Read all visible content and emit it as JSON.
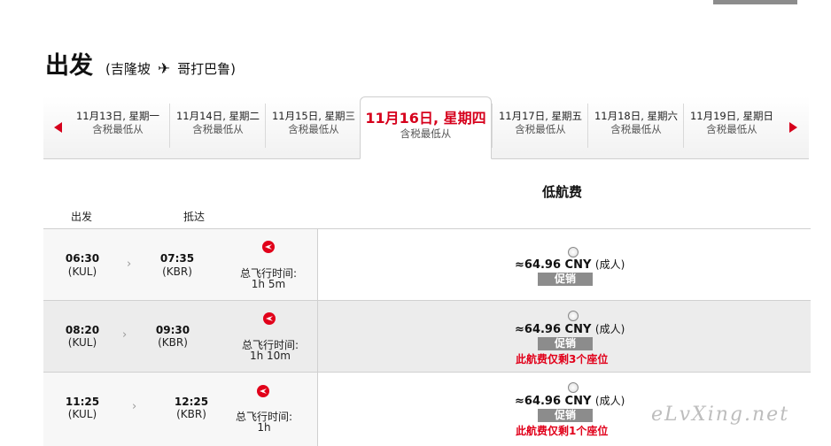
{
  "header": {
    "title": "出发",
    "origin": "(吉隆坡",
    "destination": "哥打巴鲁)"
  },
  "date_tabs": [
    {
      "date": "11月13日, 星期一",
      "sub": "含税最低从"
    },
    {
      "date": "11月14日, 星期二",
      "sub": "含税最低从"
    },
    {
      "date": "11月15日, 星期三",
      "sub": "含税最低从"
    },
    {
      "date": "11月16日, 星期四",
      "sub": "含税最低从",
      "selected": true
    },
    {
      "date": "11月17日, 星期五",
      "sub": "含税最低从"
    },
    {
      "date": "11月18日, 星期六",
      "sub": "含税最低从"
    },
    {
      "date": "11月19日, 星期日",
      "sub": "含税最低从"
    }
  ],
  "columns": {
    "departure": "出发",
    "arrival": "抵达",
    "fare": "低航费"
  },
  "flights": [
    {
      "dep_time": "06:30",
      "dep_code": "(KUL)",
      "arr_time": "07:35",
      "arr_code": "(KBR)",
      "duration_label": "总飞行时间:",
      "duration": "1h 5m",
      "price": "≈64.96 CNY",
      "pax": "(成人)",
      "promo": "促销",
      "seats": ""
    },
    {
      "dep_time": "08:20",
      "dep_code": "(KUL)",
      "arr_time": "09:30",
      "arr_code": "(KBR)",
      "duration_label": "总飞行时间:",
      "duration": "1h 10m",
      "price": "≈64.96 CNY",
      "pax": "(成人)",
      "promo": "促销",
      "seats": "此航费仅剩3个座位"
    },
    {
      "dep_time": "11:25",
      "dep_code": "(KUL)",
      "arr_time": "12:25",
      "arr_code": "(KBR)",
      "duration_label": "总飞行时间:",
      "duration": "1h",
      "price": "≈64.96 CNY",
      "pax": "(成人)",
      "promo": "促销",
      "seats": "此航费仅剩1个座位"
    }
  ],
  "watermark": "eLvXing.net",
  "colors": {
    "accent": "#e1001a",
    "promo_bg": "#8c8c8c",
    "row_alt": "#ececec"
  },
  "icons": {
    "plane": "airplane-glyph",
    "flight": "red-plane-circle-icon",
    "prev": "left-arrow-icon",
    "next": "right-arrow-icon"
  }
}
